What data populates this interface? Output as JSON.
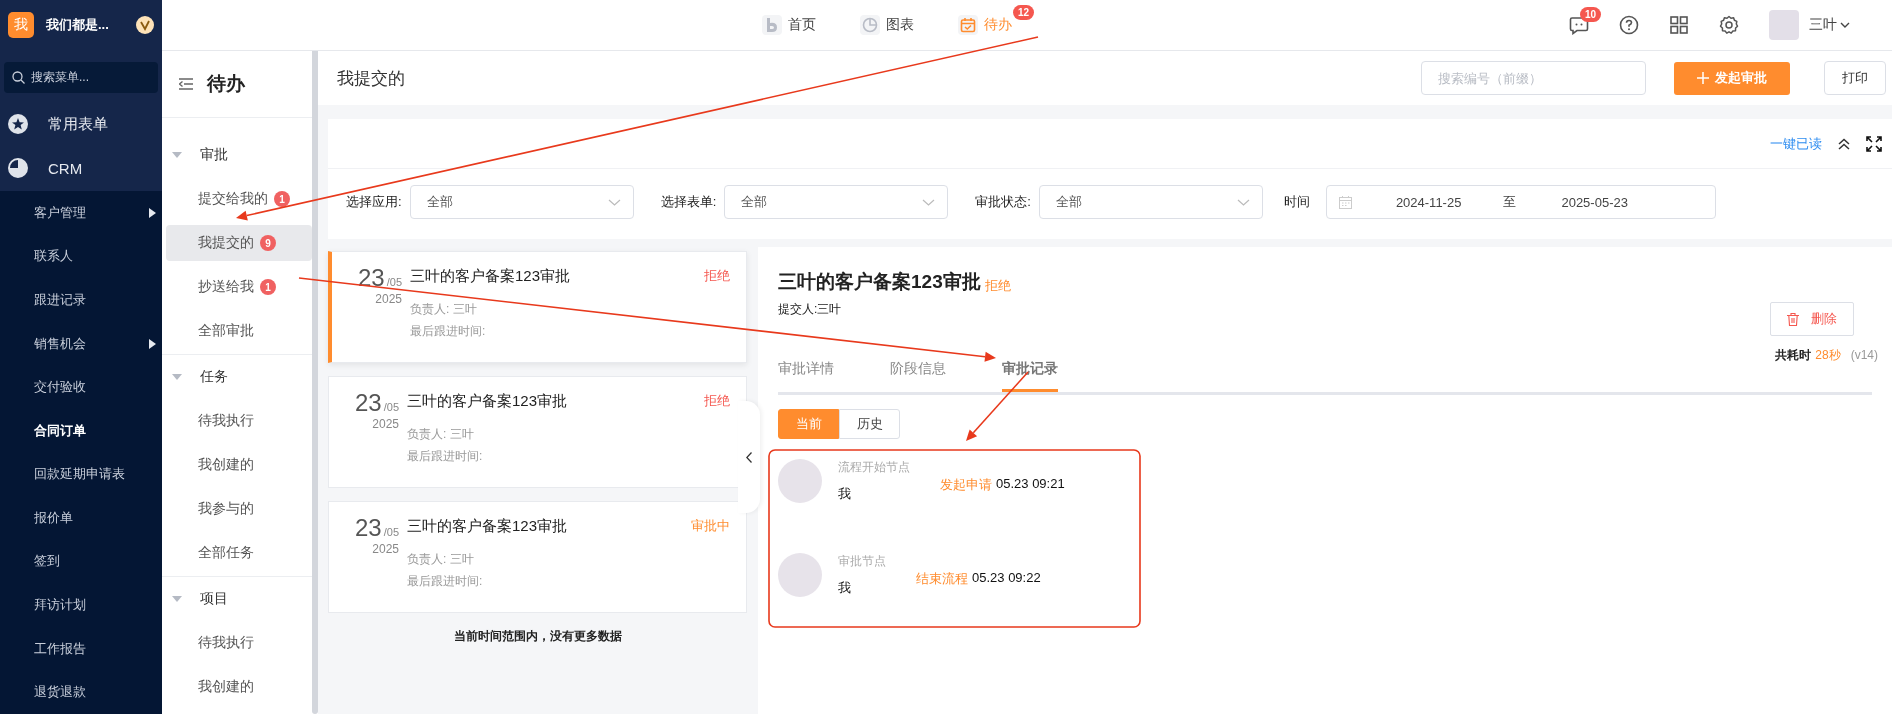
{
  "sidebar": {
    "logo": "我",
    "org_name": "我们都是...",
    "search": {
      "placeholder": "搜索菜单..."
    },
    "sections": [
      "常用表单",
      "CRM"
    ],
    "items": [
      {
        "label": "客户管理",
        "has_submenu": true,
        "selected": false
      },
      {
        "label": "联系人",
        "has_submenu": false,
        "selected": false
      },
      {
        "label": "跟进记录",
        "has_submenu": false,
        "selected": false
      },
      {
        "label": "销售机会",
        "has_submenu": true,
        "selected": false
      },
      {
        "label": "交付验收",
        "has_submenu": false,
        "selected": false
      },
      {
        "label": "合同订单",
        "has_submenu": false,
        "selected": true
      },
      {
        "label": "回款延期申请表",
        "has_submenu": false,
        "selected": false
      },
      {
        "label": "报价单",
        "has_submenu": false,
        "selected": false
      },
      {
        "label": "签到",
        "has_submenu": false,
        "selected": false
      },
      {
        "label": "拜访计划",
        "has_submenu": false,
        "selected": false
      },
      {
        "label": "工作报告",
        "has_submenu": false,
        "selected": false
      },
      {
        "label": "退货退款",
        "has_submenu": false,
        "selected": false
      }
    ]
  },
  "top_nav": [
    {
      "label": "首页",
      "selected": false
    },
    {
      "label": "图表",
      "selected": false
    },
    {
      "label": "待办",
      "selected": true,
      "badge": "12"
    }
  ],
  "header": {
    "message_badge": "10",
    "user_name": "三叶"
  },
  "todo_menu": {
    "title": "待办",
    "groups": [
      {
        "label": "审批",
        "expanded": true,
        "items": [
          {
            "label": "提交给我的",
            "badge": "1",
            "selected": false
          },
          {
            "label": "我提交的",
            "badge": "9",
            "selected": true
          },
          {
            "label": "抄送给我",
            "badge": "1",
            "selected": false
          },
          {
            "label": "全部审批",
            "selected": false
          }
        ]
      },
      {
        "label": "任务",
        "expanded": true,
        "items": [
          {
            "label": "待我执行",
            "selected": false
          },
          {
            "label": "我创建的",
            "selected": false
          },
          {
            "label": "我参与的",
            "selected": false
          },
          {
            "label": "全部任务",
            "selected": false
          }
        ]
      },
      {
        "label": "项目",
        "expanded": true,
        "items": [
          {
            "label": "待我执行",
            "selected": false
          },
          {
            "label": "我创建的",
            "selected": false
          }
        ]
      }
    ]
  },
  "page": {
    "title": "我提交的",
    "search": {
      "placeholder": "搜索编号（前缀）"
    },
    "primary_button": "发起审批",
    "print_button": "打印"
  },
  "filters": {
    "mark_all_read": "一键已读",
    "fields": [
      {
        "label": "选择应用:",
        "value": "全部"
      },
      {
        "label": "选择表单:",
        "value": "全部"
      },
      {
        "label": "审批状态:",
        "value": "全部"
      }
    ],
    "time": {
      "label": "时间",
      "start": "2024-11-25",
      "separator": "至",
      "end": "2025-05-23"
    }
  },
  "records": [
    {
      "day": "23",
      "month": "/05",
      "year": "2025",
      "title": "三叶的客户备案123审批",
      "status": "拒绝",
      "color": "#f5574f",
      "owner": "负责人: 三叶",
      "last_follow": "最后跟进时间:",
      "selected": true
    },
    {
      "day": "23",
      "month": "/05",
      "year": "2025",
      "title": "三叶的客户备案123审批",
      "status": "拒绝",
      "color": "#f5574f",
      "owner": "负责人: 三叶",
      "last_follow": "最后跟进时间:",
      "selected": false
    },
    {
      "day": "23",
      "month": "/05",
      "year": "2025",
      "title": "三叶的客户备案123审批",
      "status": "审批中",
      "color": "#ff8c2e",
      "owner": "负责人: 三叶",
      "last_follow": "最后跟进时间:",
      "selected": false
    }
  ],
  "list_footer": "当前时间范围内，没有更多数据",
  "detail": {
    "title": "三叶的客户备案123审批",
    "status": "拒绝",
    "submitter": "提交人:三叶",
    "delete_button": "删除",
    "elapsed_label": "共耗时",
    "elapsed": "28秒",
    "version": "(v14)",
    "tabs": [
      {
        "label": "审批详情",
        "selected": false
      },
      {
        "label": "阶段信息",
        "selected": false
      },
      {
        "label": "审批记录",
        "selected": true
      }
    ],
    "toggle": [
      {
        "label": "当前",
        "selected": true
      },
      {
        "label": "历史",
        "selected": false
      }
    ],
    "timeline": [
      {
        "node": "流程开始节点",
        "actor": "我",
        "action": "发起申请",
        "time": "05.23 09:21"
      },
      {
        "node": "审批节点",
        "actor": "我",
        "action": "结束流程",
        "time": "05.23 09:22"
      }
    ]
  }
}
